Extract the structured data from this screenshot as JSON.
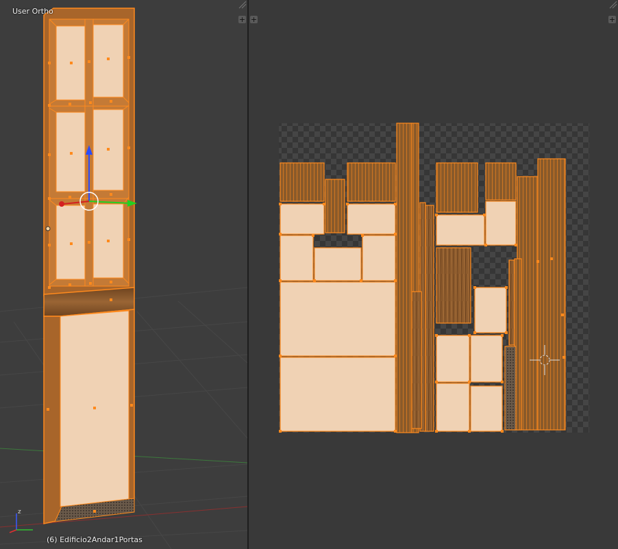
{
  "viewport_3d": {
    "view_label": "User Ortho",
    "object_label": "(6) Edificio2Andar1Portas",
    "axis_label": "z",
    "add_icon": "+",
    "icons": [
      "plus-icon",
      "transform-gizmo-icon",
      "axis-widget-icon",
      "corner-grip-icon"
    ]
  },
  "uv_editor": {
    "add_icon": "+",
    "icons": [
      "plus-icon",
      "2d-cursor-icon",
      "corner-grip-icon"
    ]
  },
  "colors": {
    "selection": "#ff8a1d",
    "face_fill": "#f0d2b4",
    "wood": "#9a6534",
    "background_3d": "#3d3d3d",
    "background_uv": "#393939",
    "checker_dark": "#363636",
    "checker_light": "#454545"
  }
}
